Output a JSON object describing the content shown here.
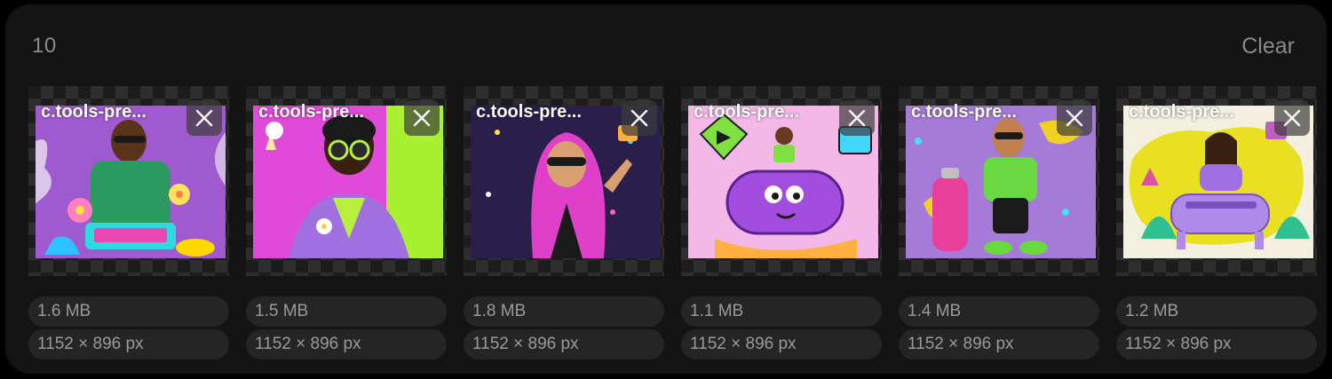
{
  "header": {
    "count": "10",
    "clear_label": "Clear"
  },
  "files": [
    {
      "name": "c.tools-pre...",
      "size": "1.6 MB",
      "dimensions": "1152 × 896 px",
      "thumb_bg": "#a05ad0",
      "accent": "#3ce0e8",
      "subject": "man-with-sunglasses-and-flowers"
    },
    {
      "name": "c.tools-pre...",
      "size": "1.5 MB",
      "dimensions": "1152 × 896 px",
      "thumb_bg": "#e04ad8",
      "accent": "#a8f030",
      "subject": "man-with-round-sunglasses"
    },
    {
      "name": "c.tools-pre...",
      "size": "1.8 MB",
      "dimensions": "1152 × 896 px",
      "thumb_bg": "#2a1f4a",
      "accent": "#e040c8",
      "subject": "man-in-pink-hoodie"
    },
    {
      "name": "c.tools-pre...",
      "size": "1.1 MB",
      "dimensions": "1152 × 896 px",
      "thumb_bg": "#f3b8e8",
      "accent": "#a34ce0",
      "subject": "purple-tank-character"
    },
    {
      "name": "c.tools-pre...",
      "size": "1.4 MB",
      "dimensions": "1152 × 896 px",
      "thumb_bg": "#a67ad8",
      "accent": "#e8409a",
      "subject": "man-with-pink-tank"
    },
    {
      "name": "c.tools-pre...",
      "size": "1.2 MB",
      "dimensions": "1152 × 896 px",
      "thumb_bg": "#f4f0e0",
      "accent": "#e8e020",
      "subject": "woman-with-purple-machine"
    }
  ]
}
